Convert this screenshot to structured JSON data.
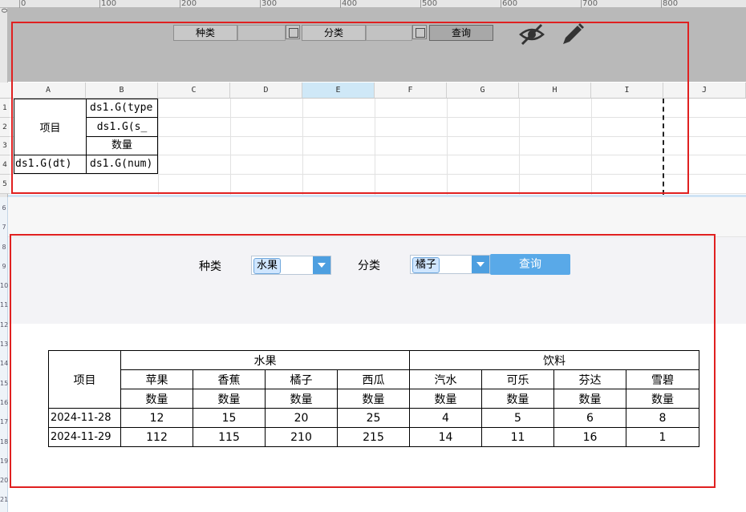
{
  "ruler": {
    "marks": [
      "0",
      "100",
      "200",
      "300",
      "400",
      "500",
      "600",
      "700",
      "800"
    ]
  },
  "designer": {
    "param_bar": {
      "type_label": "种类",
      "category_label": "分类",
      "query_label": "查询"
    },
    "columns": [
      "A",
      "B",
      "C",
      "D",
      "E",
      "F",
      "G",
      "H",
      "I",
      "J"
    ],
    "rows": [
      "1",
      "2",
      "3",
      "4",
      "5"
    ],
    "cells": {
      "item": "项目",
      "b1": "ds1.G(type",
      "b2": "ds1.G(s_",
      "b3": "数量",
      "a4": "ds1.G(dt)",
      "b4": "ds1.G(num)"
    },
    "extra_rows": [
      "6",
      "7",
      "8",
      "9",
      "10",
      "11",
      "12",
      "13",
      "14",
      "15",
      "16",
      "17",
      "18",
      "19",
      "20",
      "21"
    ]
  },
  "preview": {
    "type_label": "种类",
    "type_value": "水果",
    "category_label": "分类",
    "category_value": "橘子",
    "query_label": "查询",
    "report": {
      "corner": "项目",
      "groups": [
        "水果",
        "饮料"
      ],
      "items": [
        "苹果",
        "香蕉",
        "橘子",
        "西瓜",
        "汽水",
        "可乐",
        "芬达",
        "雪碧"
      ],
      "measure": "数量",
      "rows": [
        {
          "date": "2024-11-28",
          "values": [
            "12",
            "15",
            "20",
            "25",
            "4",
            "5",
            "6",
            "8"
          ]
        },
        {
          "date": "2024-11-29",
          "values": [
            "112",
            "115",
            "210",
            "215",
            "14",
            "11",
            "16",
            "1"
          ]
        }
      ]
    }
  },
  "colors": {
    "frame": "#e02020",
    "accent": "#59a9e8"
  }
}
